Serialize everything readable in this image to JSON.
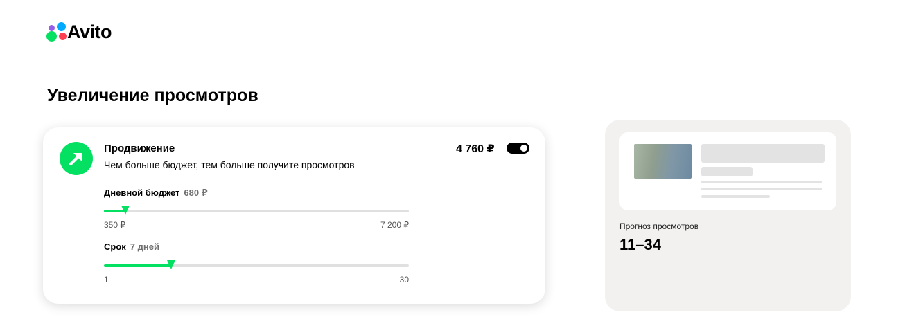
{
  "header": {
    "logo_text": "Avito"
  },
  "page": {
    "title": "Увеличение просмотров"
  },
  "promotion": {
    "icon": "arrow-up-right-icon",
    "title": "Продвижение",
    "subtitle": "Чем больше бюджет, тем больше получите просмотров",
    "price": "4 760 ₽",
    "enabled": true,
    "budget": {
      "label": "Дневной бюджет",
      "value": "680 ₽",
      "min": "350 ₽",
      "max": "7 200 ₽",
      "fraction": 0.07
    },
    "duration": {
      "label": "Срок",
      "value": "7 дней",
      "min": "1",
      "max": "30",
      "fraction": 0.22
    }
  },
  "forecast": {
    "label": "Прогноз просмотров",
    "value": "11–34"
  },
  "colors": {
    "accent_green": "#04e061",
    "card_bg": "#f2f1f0",
    "logo_purple": "#965eeb",
    "logo_blue": "#00aaff",
    "logo_red": "#ff4053"
  }
}
